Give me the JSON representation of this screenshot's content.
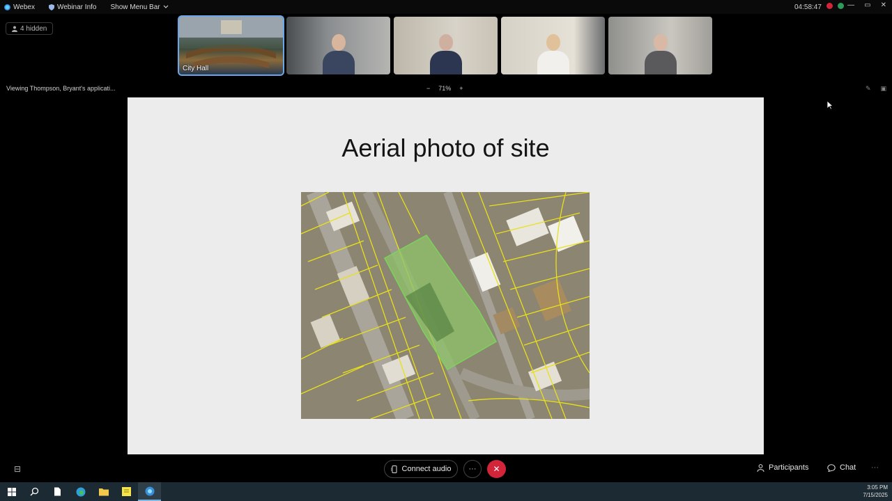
{
  "titlebar": {
    "app_name": "Webex",
    "webinar_info": "Webinar Info",
    "show_menu_bar": "Show Menu Bar",
    "clock": "04:58:47"
  },
  "stage": {
    "hidden_count_label": "4 hidden",
    "viewing_label": "Viewing Thompson, Bryant's applicati...",
    "zoom_level": "71%",
    "zoom_minus": "−",
    "zoom_plus": "+"
  },
  "thumbnails": [
    {
      "name": "City Hall",
      "active": true
    },
    {
      "name": "",
      "active": false
    },
    {
      "name": "",
      "active": false
    },
    {
      "name": "",
      "active": false
    },
    {
      "name": "",
      "active": false
    }
  ],
  "slide": {
    "title": "Aerial photo of site"
  },
  "controls": {
    "connect_audio": "Connect audio",
    "more": "···",
    "participants": "Participants",
    "chat": "Chat",
    "more_right": "···"
  },
  "taskbar": {
    "time": "3:05 PM",
    "date": "7/15/2025"
  },
  "colors": {
    "end_call": "#d3253a",
    "active_thumb": "#6aa6e8",
    "parcel_lines": "#e8e01a",
    "site_highlight": "#7bd35a"
  }
}
